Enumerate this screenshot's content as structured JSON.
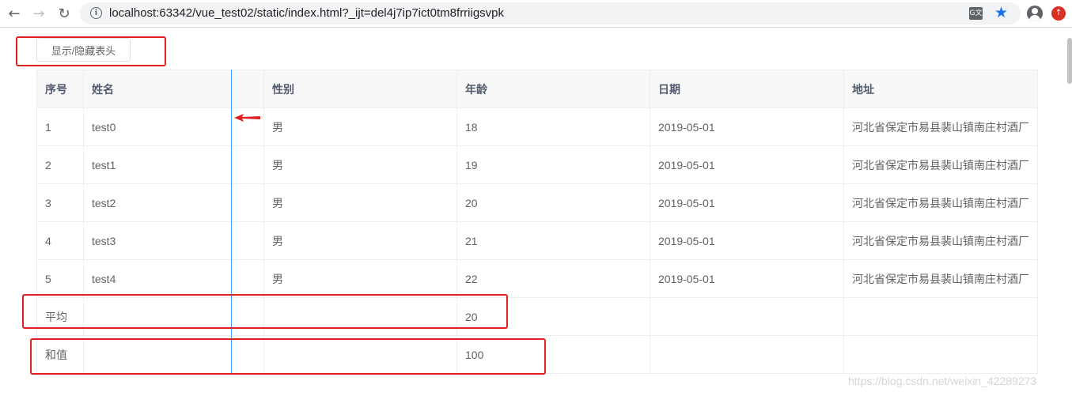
{
  "browser": {
    "url": "localhost:63342/vue_test02/static/index.html?_ijt=del4j7ip7ict0tm8frriigsvpk",
    "icons": {
      "back": "arrow-left-icon",
      "forward": "arrow-right-icon",
      "reload": "reload-icon",
      "info": "info-icon",
      "translate": "translate-icon",
      "bookmark": "star-icon",
      "profile": "avatar-icon",
      "extension": "extension-icon"
    },
    "accent": "#1a73e8"
  },
  "toolbar": {
    "toggle_label": "显示/隐藏表头"
  },
  "table": {
    "columns": [
      "序号",
      "姓名",
      "性别",
      "年龄",
      "日期",
      "地址"
    ],
    "rows": [
      [
        "1",
        "test0",
        "男",
        "18",
        "2019-05-01",
        "河北省保定市易县裴山镇南庄村酒厂"
      ],
      [
        "2",
        "test1",
        "男",
        "19",
        "2019-05-01",
        "河北省保定市易县裴山镇南庄村酒厂"
      ],
      [
        "3",
        "test2",
        "男",
        "20",
        "2019-05-01",
        "河北省保定市易县裴山镇南庄村酒厂"
      ],
      [
        "4",
        "test3",
        "男",
        "21",
        "2019-05-01",
        "河北省保定市易县裴山镇南庄村酒厂"
      ],
      [
        "5",
        "test4",
        "男",
        "22",
        "2019-05-01",
        "河北省保定市易县裴山镇南庄村酒厂"
      ]
    ],
    "summary": [
      [
        "平均",
        "",
        "",
        "20",
        "",
        ""
      ],
      [
        "和值",
        "",
        "",
        "100",
        "",
        ""
      ]
    ]
  },
  "colors": {
    "annotation": "#e02020",
    "resize_line": "#409eff"
  },
  "watermark": "https://blog.csdn.net/weixin_42289273"
}
